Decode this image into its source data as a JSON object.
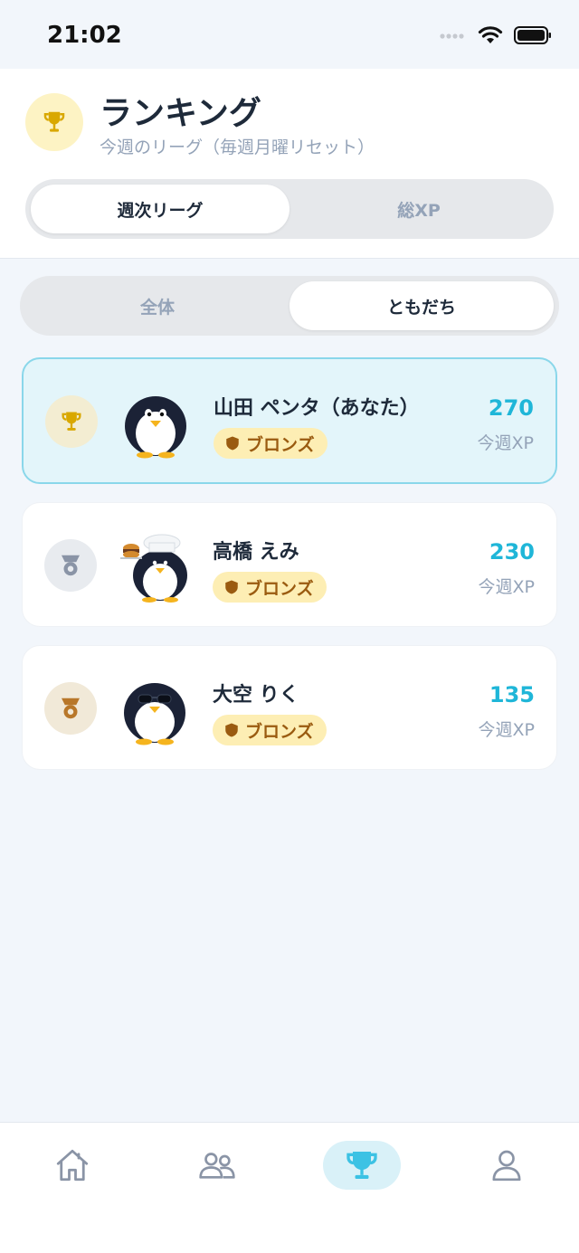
{
  "status_bar": {
    "time": "21:02"
  },
  "header": {
    "title": "ランキング",
    "subtitle": "今週のリーグ（毎週月曜リセット）",
    "tabs": [
      {
        "label": "週次リーグ",
        "active": true
      },
      {
        "label": "総XP",
        "active": false
      }
    ]
  },
  "filter": {
    "tabs": [
      {
        "label": "全体",
        "active": false
      },
      {
        "label": "ともだち",
        "active": true
      }
    ]
  },
  "ranking": [
    {
      "name": "山田 ペンタ（あなた）",
      "league": "ブロンズ",
      "xp": "270",
      "xp_label": "今週XP",
      "rank_icon": "trophy-icon",
      "is_me": true
    },
    {
      "name": "高橋 えみ",
      "league": "ブロンズ",
      "xp": "230",
      "xp_label": "今週XP",
      "rank_icon": "medal-icon",
      "is_me": false
    },
    {
      "name": "大空 りく",
      "league": "ブロンズ",
      "xp": "135",
      "xp_label": "今週XP",
      "rank_icon": "medal-icon",
      "is_me": false
    }
  ],
  "tabbar": {
    "items": [
      {
        "icon": "home-icon",
        "active": false
      },
      {
        "icon": "friends-icon",
        "active": false
      },
      {
        "icon": "trophy-icon",
        "active": true
      },
      {
        "icon": "profile-icon",
        "active": false
      }
    ]
  },
  "colors": {
    "accent": "#1fb6d8",
    "gold": "#d9a800",
    "silver": "#8a94a6",
    "bronze": "#b8772a",
    "badge_bg": "#fdeeb4"
  }
}
